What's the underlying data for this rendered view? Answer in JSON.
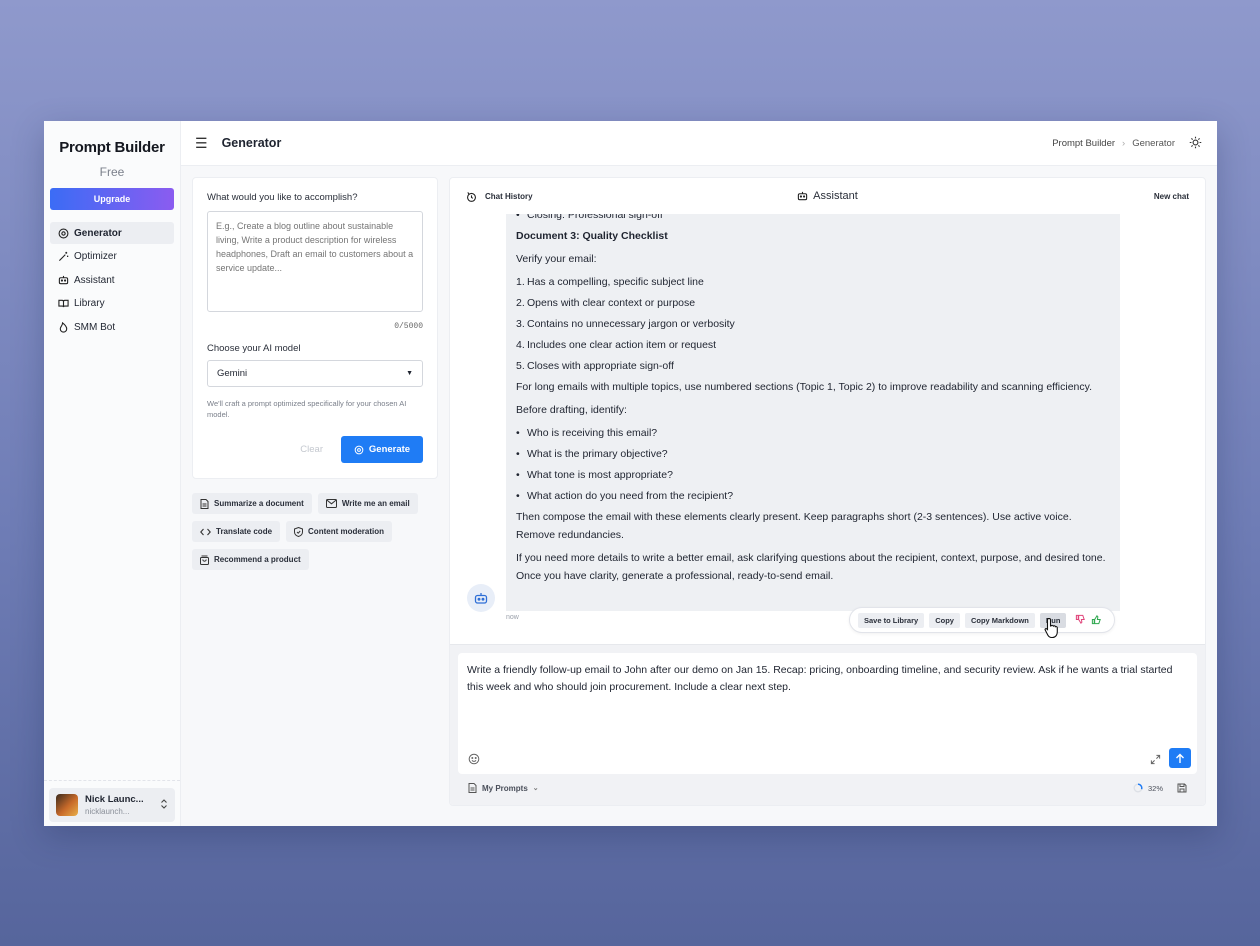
{
  "sidebar": {
    "brand": "Prompt Builder",
    "plan": "Free",
    "upgrade_label": "Upgrade",
    "items": [
      {
        "label": "Generator",
        "icon": "generator-icon",
        "active": true
      },
      {
        "label": "Optimizer",
        "icon": "magic-wand-icon"
      },
      {
        "label": "Assistant",
        "icon": "chat-bot-icon"
      },
      {
        "label": "Library",
        "icon": "book-icon"
      },
      {
        "label": "SMM Bot",
        "icon": "flame-icon"
      }
    ],
    "user": {
      "name": "Nick Launc...",
      "email": "nicklaunch..."
    }
  },
  "topbar": {
    "title": "Generator",
    "breadcrumb": [
      "Prompt Builder",
      "Generator"
    ]
  },
  "generator": {
    "question": "What would you like to accomplish?",
    "placeholder": "E.g., Create a blog outline about sustainable living, Write a product description for wireless headphones, Draft an email to customers about a service update...",
    "char_count": "0/5000",
    "model_label": "Choose your AI model",
    "model_value": "Gemini",
    "hint": "We'll craft a prompt optimized specifically for your chosen AI model.",
    "clear_label": "Clear",
    "generate_label": "Generate"
  },
  "chips": [
    {
      "label": "Summarize a document",
      "icon": "document-icon"
    },
    {
      "label": "Write me an email",
      "icon": "mail-icon"
    },
    {
      "label": "Translate code",
      "icon": "code-icon"
    },
    {
      "label": "Content moderation",
      "icon": "shield-icon"
    },
    {
      "label": "Recommend a product",
      "icon": "bag-icon"
    }
  ],
  "chat": {
    "history_label": "Chat History",
    "assistant_label": "Assistant",
    "new_chat_label": "New chat",
    "message": {
      "closing_line": "Closing: Professional sign-off",
      "doc3_title": "Document 3: Quality Checklist",
      "verify": "Verify your email:",
      "checklist": [
        "Has a compelling, specific subject line",
        "Opens with clear context or purpose",
        "Contains no unnecessary jargon or verbosity",
        "Includes one clear action item or request",
        "Closes with appropriate sign-off"
      ],
      "long_emails": "For long emails with multiple topics, use numbered sections (Topic 1, Topic 2) to improve readability and scanning efficiency.",
      "before": "Before drafting, identify:",
      "identify": [
        "Who is receiving this email?",
        "What is the primary objective?",
        "What tone is most appropriate?",
        "What action do you need from the recipient?"
      ],
      "compose": "Then compose the email with these elements clearly present. Keep paragraphs short (2-3 sentences). Use active voice. Remove redundancies.",
      "more": "If you need more details to write a better email, ask clarifying questions about the recipient, context, purpose, and desired tone. Once you have clarity, generate a professional, ready-to-send email."
    },
    "timestamp": "now",
    "actions": {
      "save": "Save to Library",
      "copy": "Copy",
      "copy_md": "Copy Markdown",
      "run": "Run"
    },
    "input_text": "Write a friendly follow-up email to John after our demo on Jan 15. Recap: pricing, onboarding timeline, and security review. Ask if he wants a trial started this week and who should join procurement. Include a clear next step.",
    "my_prompts_label": "My Prompts",
    "progress": "32%"
  },
  "colors": {
    "accent": "#1f7cf5",
    "upgrade_from": "#3b6cf5",
    "upgrade_to": "#8b5cf0"
  }
}
